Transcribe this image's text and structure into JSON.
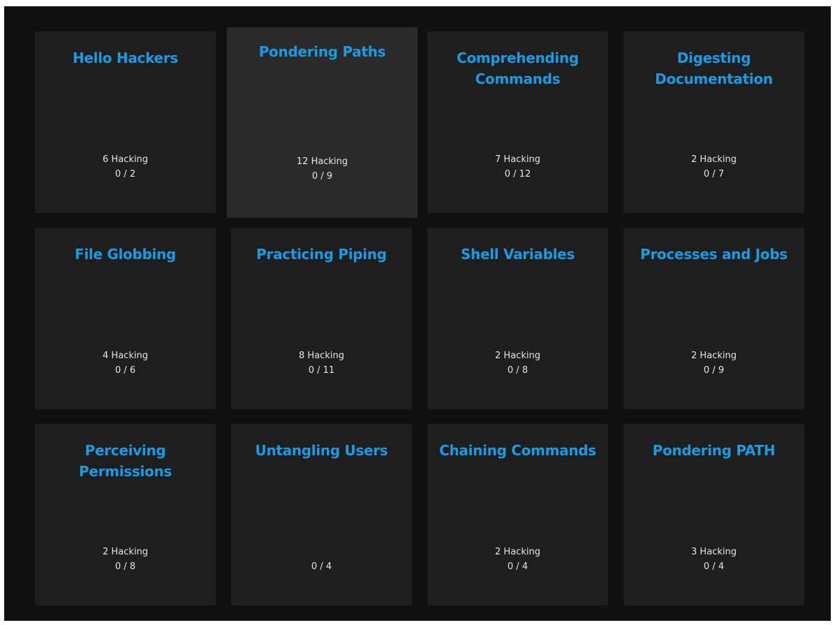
{
  "modules": [
    {
      "title": "Hello Hackers",
      "hacking": "6 Hacking",
      "progress": "0 / 2"
    },
    {
      "title": "Pondering Paths",
      "hacking": "12 Hacking",
      "progress": "0 / 9"
    },
    {
      "title": "Comprehending Commands",
      "hacking": "7 Hacking",
      "progress": "0 / 12"
    },
    {
      "title": "Digesting Documentation",
      "hacking": "2 Hacking",
      "progress": "0 / 7"
    },
    {
      "title": "File Globbing",
      "hacking": "4 Hacking",
      "progress": "0 / 6"
    },
    {
      "title": "Practicing Piping",
      "hacking": "8 Hacking",
      "progress": "0 / 11"
    },
    {
      "title": "Shell Variables",
      "hacking": "2 Hacking",
      "progress": "0 / 8"
    },
    {
      "title": "Processes and Jobs",
      "hacking": "2 Hacking",
      "progress": "0 / 9"
    },
    {
      "title": "Perceiving Permissions",
      "hacking": "2 Hacking",
      "progress": "0 / 8"
    },
    {
      "title": "Untangling Users",
      "hacking": "",
      "progress": "0 / 4"
    },
    {
      "title": "Chaining Commands",
      "hacking": "2 Hacking",
      "progress": "0 / 4"
    },
    {
      "title": "Pondering PATH",
      "hacking": "3 Hacking",
      "progress": "0 / 4"
    }
  ],
  "colors": {
    "title": "#1a9be6",
    "card": "#1e1e1e",
    "card_hover": "#2a2a2a",
    "background": "#101010",
    "stats_text": "#e6e6e6"
  }
}
